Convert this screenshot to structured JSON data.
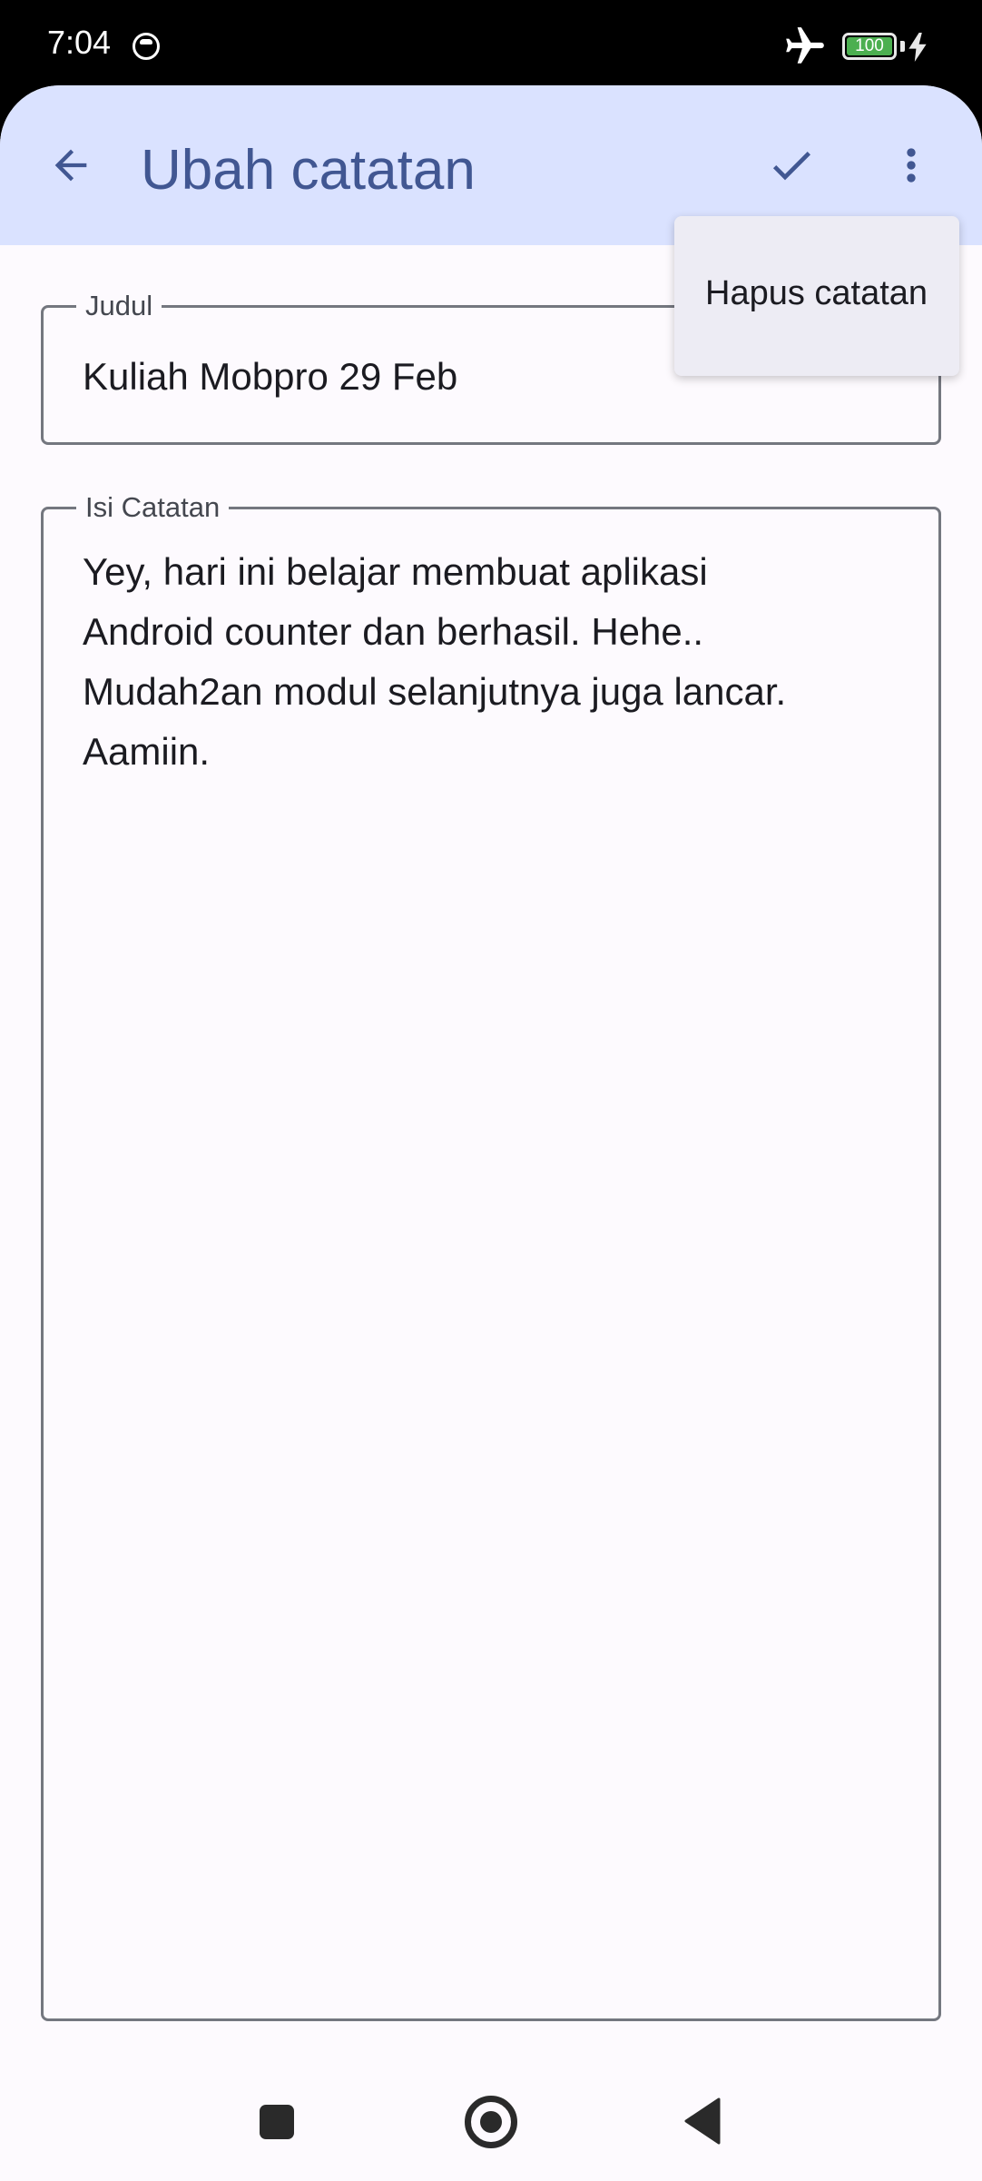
{
  "status_bar": {
    "time": "7:04",
    "battery_level": "100",
    "icons": [
      "notification-face-icon",
      "airplane-mode-icon",
      "battery-icon",
      "charging-bolt-icon"
    ]
  },
  "app_bar": {
    "title": "Ubah catatan",
    "back_icon": "arrow-back-icon",
    "confirm_icon": "check-icon",
    "more_icon": "more-vert-icon"
  },
  "menu": {
    "items": [
      {
        "label": "Hapus catatan"
      }
    ]
  },
  "form": {
    "title_field": {
      "label": "Judul",
      "value": "Kuliah Mobpro 29 Feb"
    },
    "body_field": {
      "label": "Isi Catatan",
      "value": "Yey, hari ini belajar membuat aplikasi\nAndroid counter dan berhasil. Hehe..\nMudah2an modul selanjutnya juga lancar.\nAamiin."
    }
  },
  "nav_bar": {
    "icons": [
      "recents-icon",
      "home-icon",
      "back-triangle-icon"
    ]
  },
  "colors": {
    "app_bar": "#dae2ff",
    "primary": "#415792",
    "surface": "#fdfafe",
    "menu_surface": "#edecf4",
    "outline": "#74777f",
    "battery": "#4caf50"
  }
}
